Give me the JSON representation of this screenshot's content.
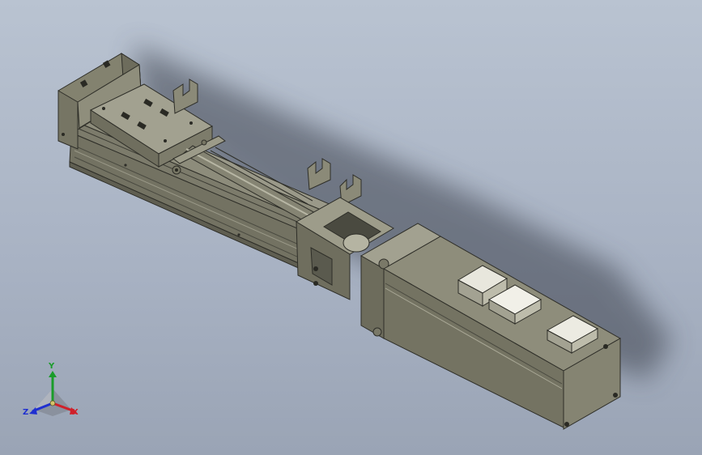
{
  "viewport": {
    "background_top": "#b9c3d1",
    "background_bottom": "#9aa4b5",
    "model_color": "#7f7e6e",
    "model_shadow": "#3d434d"
  },
  "triad": {
    "x_label": "X",
    "y_label": "Y",
    "z_label": "Z",
    "x_color": "#d0202a",
    "y_color": "#1a9c2a",
    "z_color": "#1f2fd0"
  }
}
